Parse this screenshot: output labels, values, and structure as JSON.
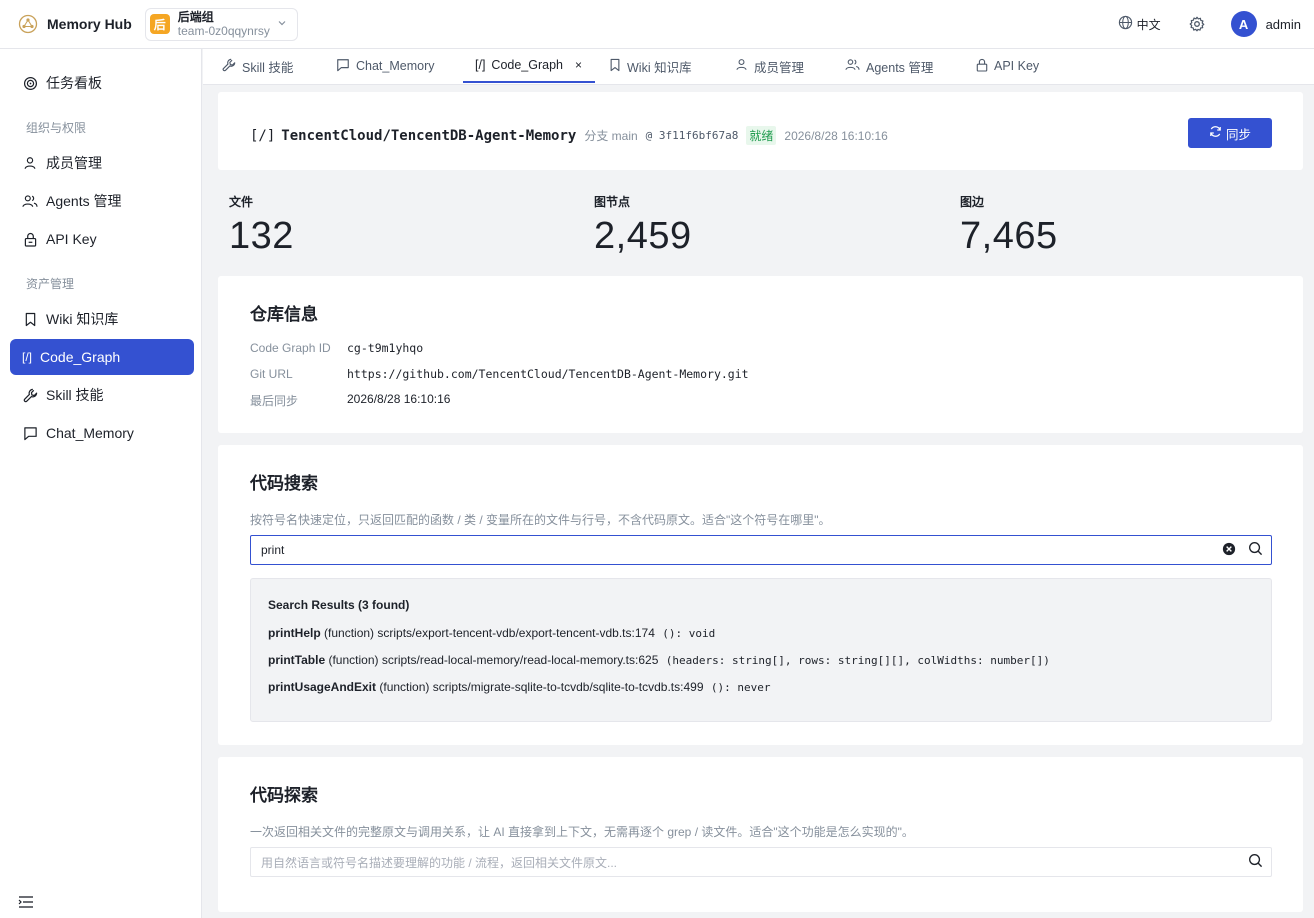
{
  "app": {
    "name": "Memory Hub"
  },
  "team": {
    "badge": "后",
    "name": "后端组",
    "id": "team-0z0qqynrsy"
  },
  "topbar": {
    "language": "中文",
    "avatar_initial": "A",
    "username": "admin"
  },
  "sidebar": {
    "dashboard": "任务看板",
    "group_org": "组织与权限",
    "members": "成员管理",
    "agents": "Agents 管理",
    "api_key": "API Key",
    "group_assets": "资产管理",
    "wiki": "Wiki 知识库",
    "code_graph_icon": "[/]",
    "code_graph": "Code_Graph",
    "skill": "Skill 技能",
    "chat_memory": "Chat_Memory"
  },
  "tabs": {
    "skill": "Skill 技能",
    "chat_memory": "Chat_Memory",
    "code_graph_icon": "[/]",
    "code_graph": "Code_Graph",
    "close": "×",
    "wiki": "Wiki 知识库",
    "members": "成员管理",
    "agents": "Agents 管理",
    "api_key": "API Key"
  },
  "repo": {
    "icon": "[/]",
    "name": "TencentCloud/TencentDB-Agent-Memory",
    "branch": "分支 main",
    "commit": "@ 3f11f6bf67a8",
    "status": "就绪",
    "synced_at": "2026/8/28 16:10:16",
    "sync_label": "同步"
  },
  "stats": {
    "files_label": "文件",
    "files_value": "132",
    "nodes_label": "图节点",
    "nodes_value": "2,459",
    "edges_label": "图边",
    "edges_value": "7,465"
  },
  "repo_info": {
    "title": "仓库信息",
    "id_label": "Code Graph ID",
    "id_value": "cg-t9m1yhqo",
    "url_label": "Git URL",
    "url_value": "https://github.com/TencentCloud/TencentDB-Agent-Memory.git",
    "sync_label": "最后同步",
    "sync_value": "2026/8/28 16:10:16"
  },
  "code_search": {
    "title": "代码搜索",
    "description": "按符号名快速定位，只返回匹配的函数 / 类 / 变量所在的文件与行号，不含代码原文。适合\"这个符号在哪里\"。",
    "query": "print",
    "results_title": "Search Results (3 found)",
    "results": [
      {
        "symbol": "printHelp",
        "kind": "(function)",
        "location": "scripts/export-tencent-vdb/export-tencent-vdb.ts:174",
        "signature": "(): void"
      },
      {
        "symbol": "printTable",
        "kind": "(function)",
        "location": "scripts/read-local-memory/read-local-memory.ts:625",
        "signature": "(headers: string[], rows: string[][], colWidths: number[])"
      },
      {
        "symbol": "printUsageAndExit",
        "kind": "(function)",
        "location": "scripts/migrate-sqlite-to-tcvdb/sqlite-to-tcvdb.ts:499",
        "signature": "(): never"
      }
    ]
  },
  "code_explore": {
    "title": "代码探索",
    "description": "一次返回相关文件的完整原文与调用关系，让 AI 直接拿到上下文，无需再逐个 grep / 读文件。适合\"这个功能是怎么实现的\"。",
    "placeholder": "用自然语言或符号名描述要理解的功能 / 流程，返回相关文件原文..."
  },
  "colors": {
    "accent": "#3451d1",
    "status_green": "#1f9b4e",
    "team_badge": "#f5a623"
  }
}
